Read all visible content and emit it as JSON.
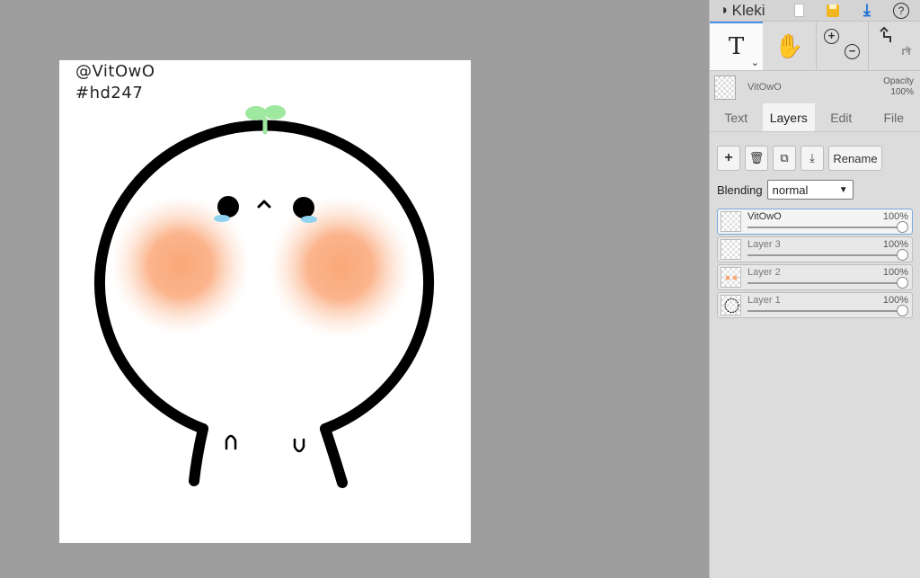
{
  "app": {
    "logo_text": "Kleki",
    "logo_icon": "kleki-logo-icon"
  },
  "topbar": {
    "buttons": [
      "new-image-icon",
      "save-icon",
      "download-icon",
      "help-icon"
    ],
    "help_label": "?"
  },
  "tools": {
    "text_tool": "T",
    "hand_tool": "hand-icon",
    "zoom_in": "+",
    "zoom_out": "−",
    "undo_icon": "undo-icon",
    "redo_icon": "redo-icon"
  },
  "current_layer": {
    "name": "VitOwO",
    "opacity_label": "Opacity",
    "opacity_value": "100%"
  },
  "tabs": [
    {
      "label": "Text",
      "active": false
    },
    {
      "label": "Layers",
      "active": true
    },
    {
      "label": "Edit",
      "active": false
    },
    {
      "label": "File",
      "active": false
    }
  ],
  "layer_actions": {
    "add": "+",
    "delete": "trash-icon",
    "duplicate": "duplicate-icon",
    "merge": "merge-down-icon",
    "rename": "Rename"
  },
  "blending": {
    "label": "Blending",
    "value": "normal"
  },
  "layers": [
    {
      "name": "VitOwO",
      "opacity": "100%",
      "selected": true
    },
    {
      "name": "Layer 3",
      "opacity": "100%",
      "selected": false
    },
    {
      "name": "Layer 2",
      "opacity": "100%",
      "selected": false
    },
    {
      "name": "Layer 1",
      "opacity": "100%",
      "selected": false
    }
  ],
  "canvas": {
    "line1": "@VitOwO",
    "line2": "#hd247"
  },
  "colors": {
    "accent": "#4a90e2",
    "blush": "#f9a878",
    "sprout": "#9fe8a0",
    "tear": "#8fd3f0"
  }
}
